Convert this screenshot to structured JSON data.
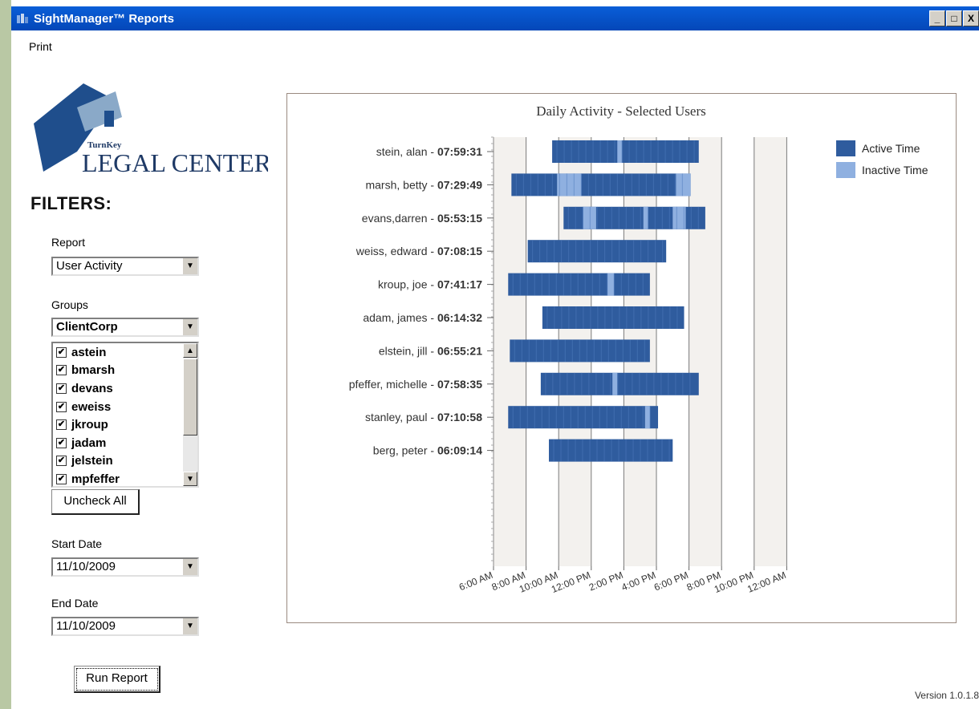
{
  "window": {
    "title": "SightManager™ Reports",
    "controls": [
      "_",
      "□",
      "X"
    ]
  },
  "menu": {
    "print": "Print"
  },
  "logo": {
    "small": "TurnKey",
    "big": "LEGAL CENTER"
  },
  "filters": {
    "title": "FILTERS:",
    "report_label": "Report",
    "report_value": "User Activity",
    "groups_label": "Groups",
    "groups_value": "ClientCorp",
    "group_users": [
      "astein",
      "bmarsh",
      "devans",
      "eweiss",
      "jkroup",
      "jadam",
      "jelstein",
      "mpfeffer"
    ],
    "uncheck_all": "Uncheck All",
    "start_label": "Start Date",
    "start_value": "11/10/2009",
    "end_label": "End Date",
    "end_value": "11/10/2009",
    "run_report": "Run Report"
  },
  "version": "Version 1.0.1.8",
  "colors": {
    "active": "#2f5c9e",
    "inactive": "#8fb0e0",
    "titlebar": "#0a5ed8"
  },
  "chart_data": {
    "type": "bar",
    "title": "Daily Activity - Selected Users",
    "x_ticks": [
      "6:00 AM",
      "8:00 AM",
      "10:00 AM",
      "12:00 PM",
      "2:00 PM",
      "4:00 PM",
      "6:00 PM",
      "8:00 PM",
      "10:00 PM",
      "12:00 AM"
    ],
    "legend": [
      {
        "name": "Active Time",
        "color": "#2f5c9e"
      },
      {
        "name": "Inactive Time",
        "color": "#8fb0e0"
      }
    ],
    "rows": [
      {
        "name": "stein, alan",
        "time": "07:59:31",
        "start": 9.6,
        "end": 18.6,
        "inactive": [
          [
            13.6,
            13.9
          ]
        ]
      },
      {
        "name": "marsh, betty",
        "time": "07:29:49",
        "start": 7.1,
        "end": 18.1,
        "inactive": [
          [
            9.9,
            11.4
          ],
          [
            17.2,
            18.1
          ]
        ]
      },
      {
        "name": "evans,darren",
        "time": "05:53:15",
        "start": 10.3,
        "end": 19.0,
        "inactive": [
          [
            11.5,
            12.3
          ],
          [
            15.2,
            15.5
          ],
          [
            17.0,
            17.8
          ]
        ]
      },
      {
        "name": "weiss, edward",
        "time": "07:08:15",
        "start": 8.1,
        "end": 16.6,
        "inactive": []
      },
      {
        "name": "kroup, joe",
        "time": "07:41:17",
        "start": 6.9,
        "end": 15.6,
        "inactive": [
          [
            13.0,
            13.4
          ]
        ]
      },
      {
        "name": "adam, james",
        "time": "06:14:32",
        "start": 9.0,
        "end": 17.7,
        "inactive": []
      },
      {
        "name": "elstein, jill",
        "time": "06:55:21",
        "start": 7.0,
        "end": 15.6,
        "inactive": []
      },
      {
        "name": "pfeffer, michelle",
        "time": "07:58:35",
        "start": 8.9,
        "end": 18.6,
        "inactive": [
          [
            13.3,
            13.6
          ]
        ]
      },
      {
        "name": "stanley, paul",
        "time": "07:10:58",
        "start": 6.9,
        "end": 16.1,
        "inactive": [
          [
            15.3,
            15.6
          ]
        ]
      },
      {
        "name": "berg, peter",
        "time": "06:09:14",
        "start": 9.4,
        "end": 17.0,
        "inactive": []
      }
    ]
  }
}
